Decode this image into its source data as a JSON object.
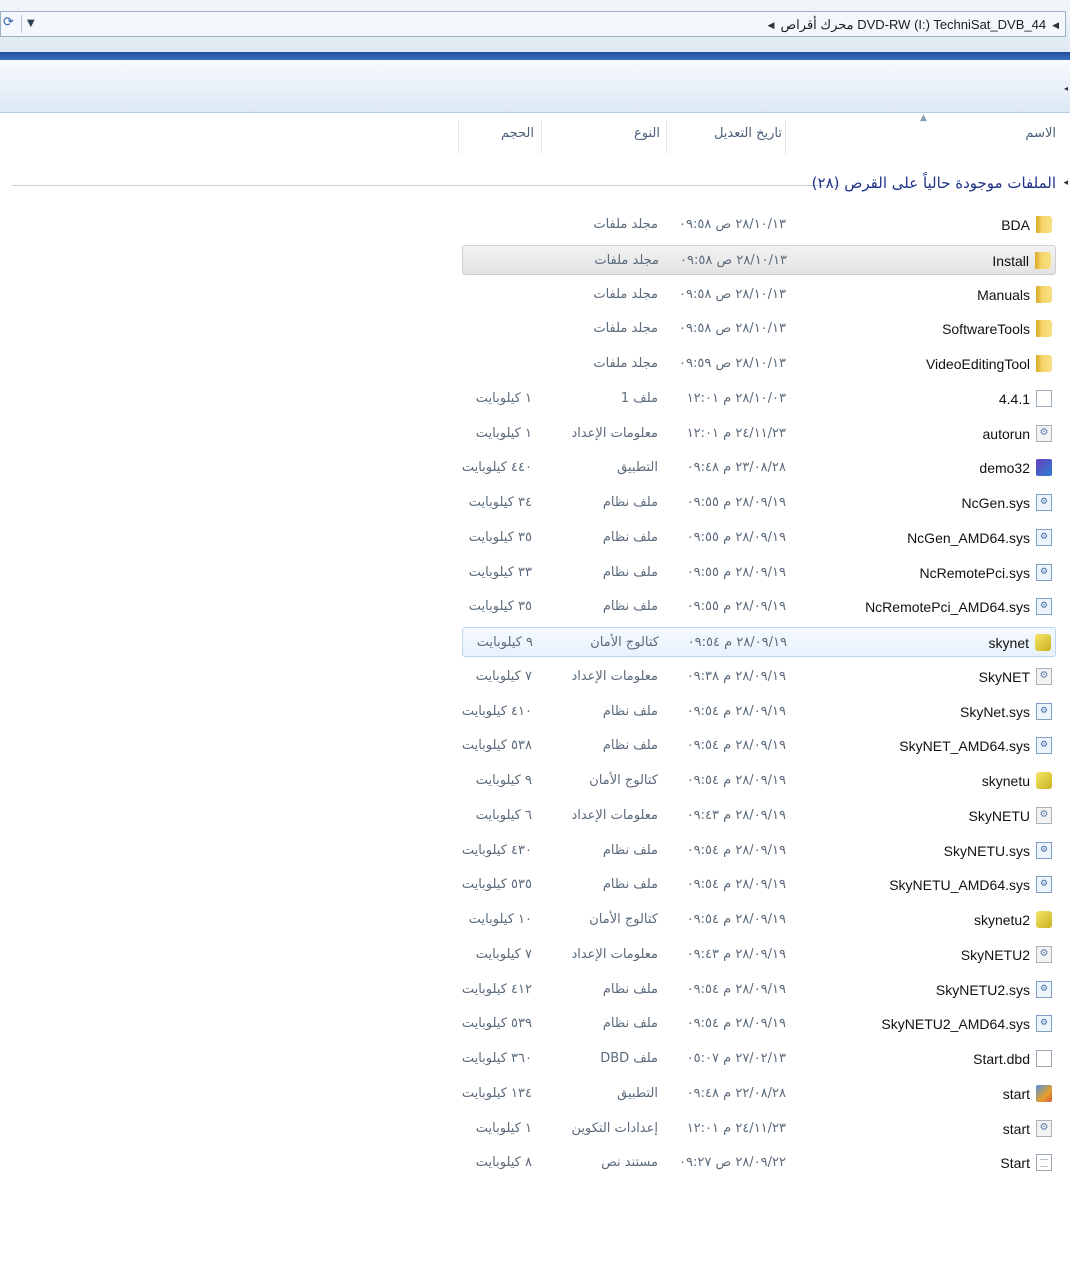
{
  "address": {
    "crumbs": [
      "محرك أقراص DVD-RW (I:) TechniSat_DVB_44"
    ]
  },
  "columns": {
    "name": "الاسم",
    "date": "تاريخ التعديل",
    "type": "النوع",
    "size": "الحجم"
  },
  "group": {
    "title": "الملفات موجودة حالياً على القرص (٢٨)"
  },
  "files": [
    {
      "name": "BDA",
      "date": "٢٨/١٠/١٣ ص ٠٩:٥٨",
      "type": "مجلد ملفات",
      "size": "",
      "icon": "folder-icon",
      "state": ""
    },
    {
      "name": "Install",
      "date": "٢٨/١٠/١٣ ص ٠٩:٥٨",
      "type": "مجلد ملفات",
      "size": "",
      "icon": "folder-icon",
      "state": "selected"
    },
    {
      "name": "Manuals",
      "date": "٢٨/١٠/١٣ ص ٠٩:٥٨",
      "type": "مجلد ملفات",
      "size": "",
      "icon": "folder-icon",
      "state": ""
    },
    {
      "name": "SoftwareTools",
      "date": "٢٨/١٠/١٣ ص ٠٩:٥٨",
      "type": "مجلد ملفات",
      "size": "",
      "icon": "folder-icon",
      "state": ""
    },
    {
      "name": "VideoEditingTool",
      "date": "٢٨/١٠/١٣ ص ٠٩:٥٩",
      "type": "مجلد ملفات",
      "size": "",
      "icon": "folder-icon",
      "state": ""
    },
    {
      "name": "4.4.1",
      "date": "٢٨/١٠/٠٣ م ١٢:٠١",
      "type": "ملف 1",
      "size": "١ كيلوبايت",
      "icon": "file-icon",
      "state": ""
    },
    {
      "name": "autorun",
      "date": "٢٤/١١/٢٣ م ١٢:٠١",
      "type": "معلومات الإعداد",
      "size": "١ كيلوبايت",
      "icon": "setup-info-icon",
      "state": ""
    },
    {
      "name": "demo32",
      "date": "٢٣/٠٨/٢٨ م ٠٩:٤٨",
      "type": "التطبيق",
      "size": "٤٤٠ كيلوبايت",
      "icon": "application-icon",
      "state": ""
    },
    {
      "name": "NcGen.sys",
      "date": "٢٨/٠٩/١٩ م ٠٩:٥٥",
      "type": "ملف نظام",
      "size": "٣٤ كيلوبايت",
      "icon": "system-file-icon",
      "state": ""
    },
    {
      "name": "NcGen_AMD64.sys",
      "date": "٢٨/٠٩/١٩ م ٠٩:٥٥",
      "type": "ملف نظام",
      "size": "٣٥ كيلوبايت",
      "icon": "system-file-icon",
      "state": ""
    },
    {
      "name": "NcRemotePci.sys",
      "date": "٢٨/٠٩/١٩ م ٠٩:٥٥",
      "type": "ملف نظام",
      "size": "٣٣ كيلوبايت",
      "icon": "system-file-icon",
      "state": ""
    },
    {
      "name": "NcRemotePci_AMD64.sys",
      "date": "٢٨/٠٩/١٩ م ٠٩:٥٥",
      "type": "ملف نظام",
      "size": "٣٥ كيلوبايت",
      "icon": "system-file-icon",
      "state": ""
    },
    {
      "name": "skynet",
      "date": "٢٨/٠٩/١٩ م ٠٩:٥٤",
      "type": "كتالوج الأمان",
      "size": "٩ كيلوبايت",
      "icon": "security-catalog-icon",
      "state": "hover"
    },
    {
      "name": "SkyNET",
      "date": "٢٨/٠٩/١٩ م ٠٩:٣٨",
      "type": "معلومات الإعداد",
      "size": "٧ كيلوبايت",
      "icon": "setup-info-icon",
      "state": ""
    },
    {
      "name": "SkyNet.sys",
      "date": "٢٨/٠٩/١٩ م ٠٩:٥٤",
      "type": "ملف نظام",
      "size": "٤١٠ كيلوبايت",
      "icon": "system-file-icon",
      "state": ""
    },
    {
      "name": "SkyNET_AMD64.sys",
      "date": "٢٨/٠٩/١٩ م ٠٩:٥٤",
      "type": "ملف نظام",
      "size": "٥٣٨ كيلوبايت",
      "icon": "system-file-icon",
      "state": ""
    },
    {
      "name": "skynetu",
      "date": "٢٨/٠٩/١٩ م ٠٩:٥٤",
      "type": "كتالوج الأمان",
      "size": "٩ كيلوبايت",
      "icon": "security-catalog-icon",
      "state": ""
    },
    {
      "name": "SkyNETU",
      "date": "٢٨/٠٩/١٩ م ٠٩:٤٣",
      "type": "معلومات الإعداد",
      "size": "٦ كيلوبايت",
      "icon": "setup-info-icon",
      "state": ""
    },
    {
      "name": "SkyNETU.sys",
      "date": "٢٨/٠٩/١٩ م ٠٩:٥٤",
      "type": "ملف نظام",
      "size": "٤٣٠ كيلوبايت",
      "icon": "system-file-icon",
      "state": ""
    },
    {
      "name": "SkyNETU_AMD64.sys",
      "date": "٢٨/٠٩/١٩ م ٠٩:٥٤",
      "type": "ملف نظام",
      "size": "٥٣٥ كيلوبايت",
      "icon": "system-file-icon",
      "state": ""
    },
    {
      "name": "skynetu2",
      "date": "٢٨/٠٩/١٩ م ٠٩:٥٤",
      "type": "كتالوج الأمان",
      "size": "١٠ كيلوبايت",
      "icon": "security-catalog-icon",
      "state": ""
    },
    {
      "name": "SkyNETU2",
      "date": "٢٨/٠٩/١٩ م ٠٩:٤٣",
      "type": "معلومات الإعداد",
      "size": "٧ كيلوبايت",
      "icon": "setup-info-icon",
      "state": ""
    },
    {
      "name": "SkyNETU2.sys",
      "date": "٢٨/٠٩/١٩ م ٠٩:٥٤",
      "type": "ملف نظام",
      "size": "٤١٢ كيلوبايت",
      "icon": "system-file-icon",
      "state": ""
    },
    {
      "name": "SkyNETU2_AMD64.sys",
      "date": "٢٨/٠٩/١٩ م ٠٩:٥٤",
      "type": "ملف نظام",
      "size": "٥٣٩ كيلوبايت",
      "icon": "system-file-icon",
      "state": ""
    },
    {
      "name": "Start.dbd",
      "date": "٢٧/٠٢/١٣ م ٠٥:٠٧",
      "type": "ملف DBD",
      "size": "٣٦٠ كيلوبايت",
      "icon": "file-icon",
      "state": ""
    },
    {
      "name": "start",
      "date": "٢٢/٠٨/٢٨ م ٠٩:٤٨",
      "type": "التطبيق",
      "size": "١٣٤ كيلوبايت",
      "icon": "application-icon-2",
      "state": ""
    },
    {
      "name": "start",
      "date": "٢٤/١١/٢٣ م ١٢:٠١",
      "type": "إعدادات التكوين",
      "size": "١ كيلوبايت",
      "icon": "config-settings-icon",
      "state": ""
    },
    {
      "name": "Start",
      "date": "٢٨/٠٩/٢٢ ص ٠٩:٢٧",
      "type": "مستند نص",
      "size": "٨ كيلوبايت",
      "icon": "text-document-icon",
      "state": ""
    }
  ]
}
